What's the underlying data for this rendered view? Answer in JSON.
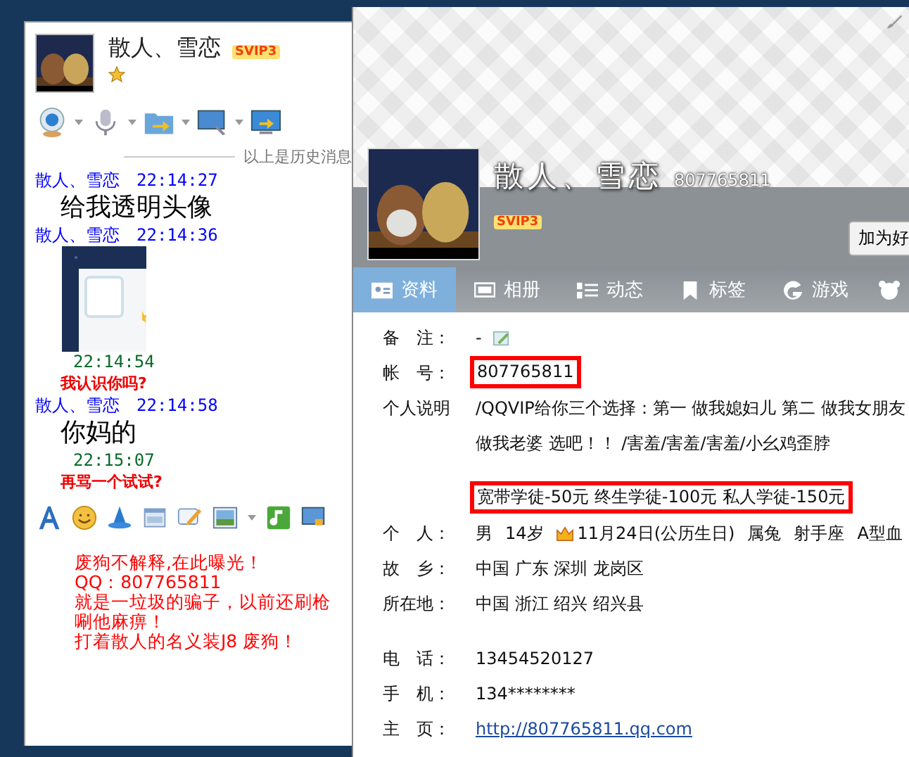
{
  "chat_window": {
    "contact_name": "散人、雪恋",
    "vip_badge": "SVIP3",
    "history_note": "以上是历史消息",
    "messages": [
      {
        "kind": "incoming",
        "sender": "散人、雪恋",
        "time": "22:14:27",
        "text": "给我透明头像"
      },
      {
        "kind": "incoming_image",
        "sender": "散人、雪恋",
        "time": "22:14:36"
      },
      {
        "kind": "outgoing",
        "time": "22:14:54",
        "text": "我认识你吗?"
      },
      {
        "kind": "incoming",
        "sender": "散人、雪恋",
        "time": "22:14:58",
        "text": "你妈的"
      },
      {
        "kind": "outgoing",
        "time": "22:15:07",
        "text": "再骂一个试试?"
      }
    ],
    "input_lines": [
      "废狗不解释,在此曝光！",
      "QQ：807765811",
      "就是一垃圾的骗子，以前还刷枪",
      "唰他麻痹！",
      "打着散人的名义装J8 废狗！"
    ]
  },
  "profile_window": {
    "name": "散人、雪恋",
    "number": "807765811",
    "vip_badge": "SVIP3",
    "add_button": "加为好",
    "tabs": [
      {
        "label": "资料",
        "selected": true
      },
      {
        "label": "相册",
        "selected": false
      },
      {
        "label": "动态",
        "selected": false
      },
      {
        "label": "标签",
        "selected": false
      },
      {
        "label": "游戏",
        "selected": false
      }
    ],
    "field_groups": [
      [
        {
          "kind": "remark",
          "label": "备　注：",
          "lines": [
            "-"
          ]
        },
        {
          "kind": "text",
          "label": "帐　号：",
          "lines": [
            "807765811"
          ],
          "highlighted": true
        },
        {
          "kind": "text",
          "label": "个人说明",
          "lines": [
            "/QQVIP给你三个选择：第一 做我媳妇儿 第二 做我女朋友",
            "做我老婆 选吧！！ /害羞/害羞/害羞/小幺鸡歪脖"
          ]
        }
      ],
      [
        {
          "kind": "text",
          "lines": [
            "宽带学徒-50元  终生学徒-100元  私人学徒-150元"
          ],
          "highlighted": true
        },
        {
          "kind": "personal",
          "label": "个　人：",
          "values": [
            "男",
            "14岁",
            "11月24日(公历生日)",
            "属兔",
            "射手座",
            "A型血"
          ]
        },
        {
          "kind": "text",
          "label": "故　乡：",
          "lines": [
            "中国 广东 深圳 龙岗区"
          ]
        },
        {
          "kind": "text",
          "label": "所在地：",
          "lines": [
            "中国 浙江 绍兴 绍兴县"
          ]
        }
      ],
      [
        {
          "kind": "text",
          "label": "电　话：",
          "lines": [
            "13454520127"
          ]
        },
        {
          "kind": "text",
          "label": "手　机：",
          "lines": [
            "134********"
          ]
        },
        {
          "kind": "link",
          "label": "主　页：",
          "lines": [
            "http://807765811.qq.com"
          ]
        }
      ]
    ]
  }
}
